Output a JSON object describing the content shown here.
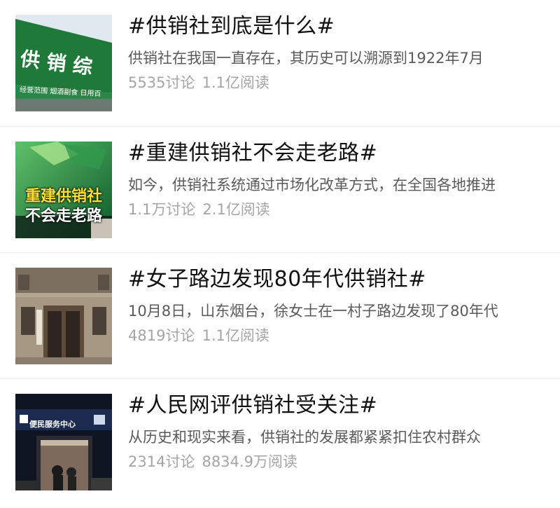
{
  "topics": [
    {
      "title": "#供销社到底是什么#",
      "summary": "供销社在我国一直存在，其历史可以溯源到1922年7月",
      "discussions": "5535讨论",
      "reads": "1.1亿阅读",
      "thumb": {
        "icon": "supply-coop-sign-photo",
        "sign_text": "供 销 综",
        "sub_text": "经营范围  烟酒副食  日用百"
      }
    },
    {
      "title": "#重建供销社不会走老路#",
      "summary": "如今，供销社系统通过市场化改革方式，在全国各地推进",
      "discussions": "1.1万讨论",
      "reads": "2.1亿阅读",
      "thumb": {
        "icon": "coop-logo-news-photo",
        "cap_line1": "重建供销社",
        "cap_line2": "不会走老路"
      }
    },
    {
      "title": "#女子路边发现80年代供销社#",
      "summary": "10月8日，山东烟台，徐女士在一村子路边发现了80年代",
      "discussions": "4819讨论",
      "reads": "1.1亿阅读",
      "thumb": {
        "icon": "old-building-photo"
      }
    },
    {
      "title": "#人民网评供销社受关注#",
      "summary": "从历史和现实来看，供销社的发展都紧紧扣住农村群众",
      "discussions": "2314讨论",
      "reads": "8834.9万阅读",
      "thumb": {
        "icon": "service-center-night-photo",
        "sign_text": "便民服务中心"
      }
    }
  ],
  "colors": {
    "title": "#111111",
    "summary": "#5a5a5a",
    "stats": "#a4a4a4",
    "divider": "#ececec",
    "coop_green": "#1f7a3a"
  }
}
